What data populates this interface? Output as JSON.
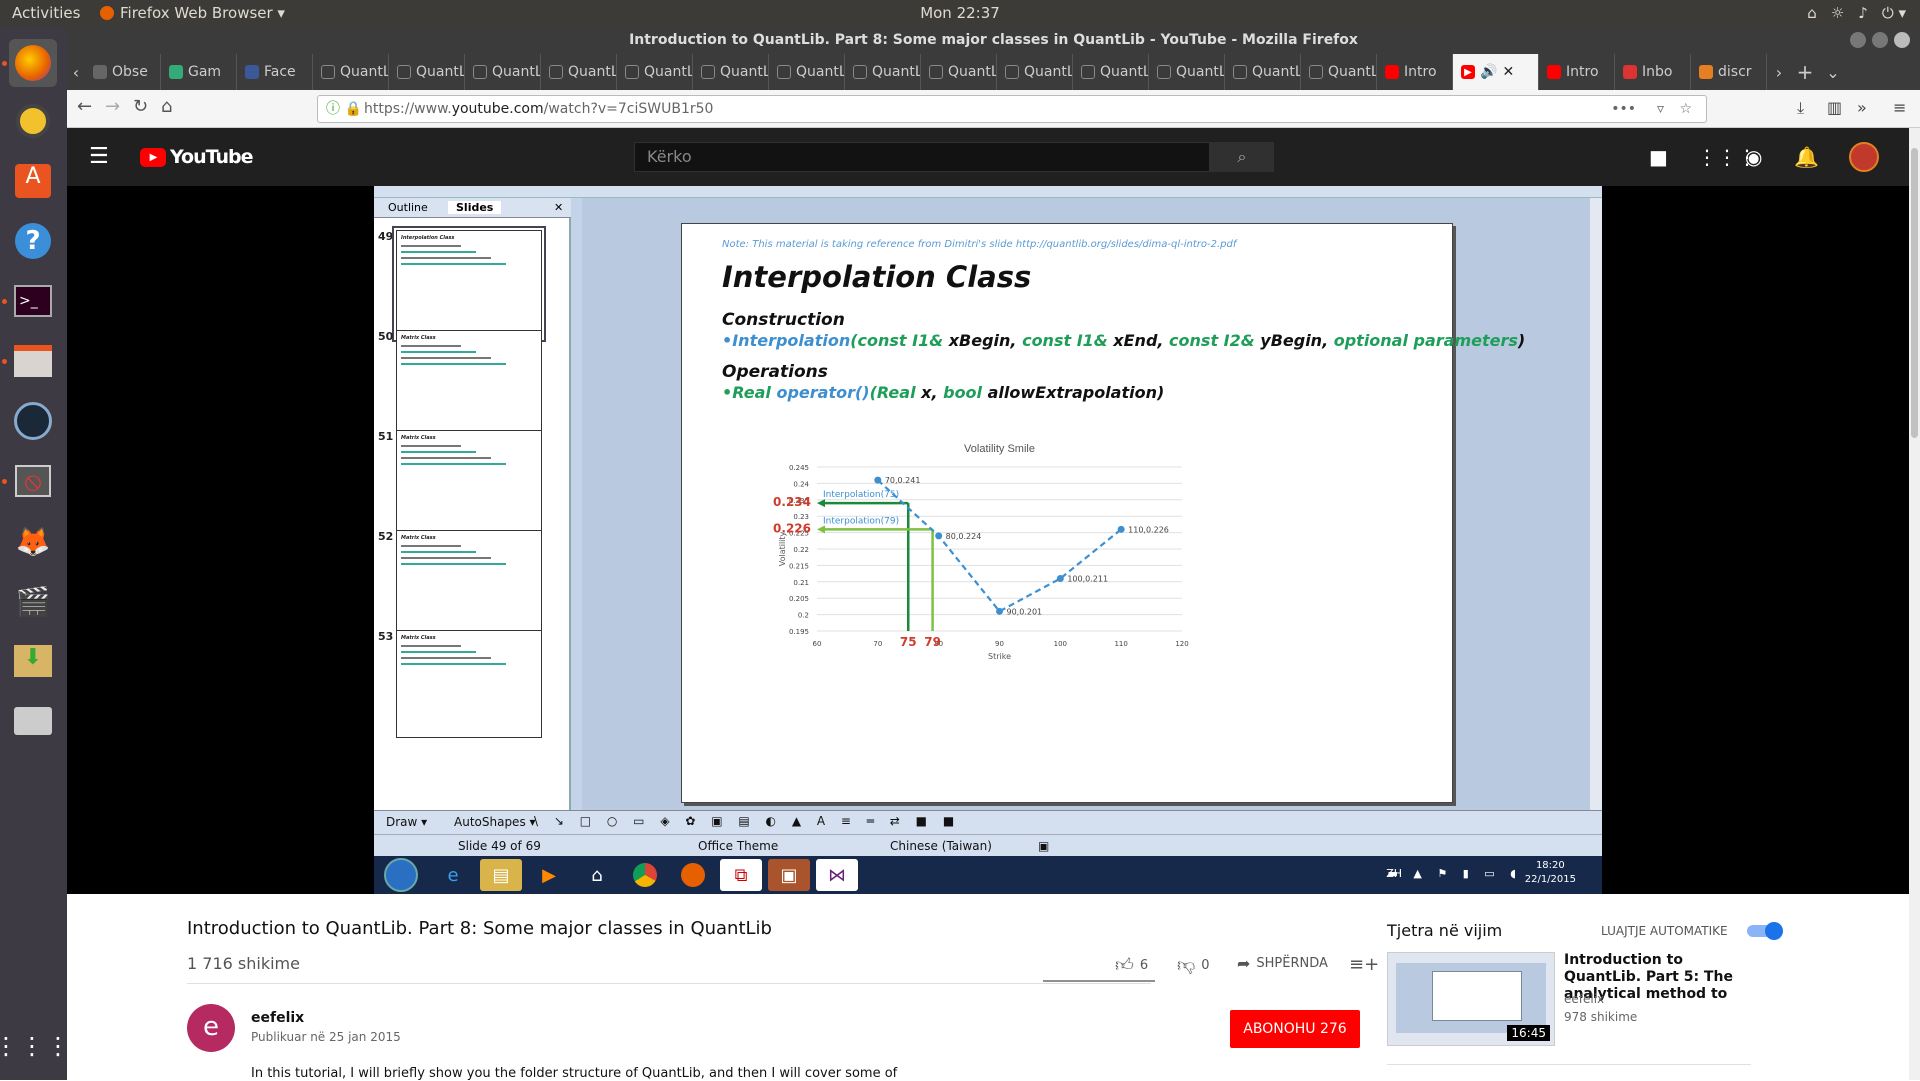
{
  "ubuntu": {
    "activities": "Activities",
    "app_menu": "Firefox Web Browser ▾",
    "clock": "Mon 22:37"
  },
  "firefox": {
    "window_title": "Introduction to QuantLib. Part 8: Some major classes in QuantLib - YouTube - Mozilla Firefox",
    "tabs": [
      {
        "label": "Obse",
        "color": "#666"
      },
      {
        "label": "Gam",
        "color": "#3a7"
      },
      {
        "label": "Face",
        "color": "#3b5998"
      },
      {
        "label": "QuantLi",
        "color": ""
      },
      {
        "label": "QuantLi",
        "color": ""
      },
      {
        "label": "QuantLi",
        "color": ""
      },
      {
        "label": "QuantLi",
        "color": ""
      },
      {
        "label": "QuantLi",
        "color": ""
      },
      {
        "label": "QuantLi",
        "color": ""
      },
      {
        "label": "QuantLi",
        "color": ""
      },
      {
        "label": "QuantLi",
        "color": ""
      },
      {
        "label": "QuantLi",
        "color": ""
      },
      {
        "label": "QuantLi",
        "color": ""
      },
      {
        "label": "QuantLi",
        "color": ""
      },
      {
        "label": "QuantLi",
        "color": ""
      },
      {
        "label": "QuantLi",
        "color": ""
      },
      {
        "label": "QuantLi",
        "color": ""
      },
      {
        "label": "Intro",
        "color": "#f00"
      }
    ],
    "active_tab_label": "",
    "tabs_after": [
      {
        "label": "Intro",
        "color": "#f00"
      },
      {
        "label": "Inbo",
        "color": "#d33"
      },
      {
        "label": "discr",
        "color": "#e67e22"
      }
    ],
    "url_prefix": "https://www.",
    "url_domain": "youtube.com",
    "url_path": "/watch?v=7ciSWUB1r50"
  },
  "youtube": {
    "logo": "YouTube",
    "search_placeholder": "Kërko",
    "video_title": "Introduction to QuantLib. Part 8: Some major classes in QuantLib",
    "views": "1 716 shikime",
    "likes": "6",
    "dislikes": "0",
    "share": "SHPËRNDA",
    "channel_initial": "e",
    "channel_name": "eefelix",
    "published": "Publikuar në 25 jan 2015",
    "subscribe": "ABONOHU",
    "subscribers": "276",
    "description": "In this tutorial, I will briefly show you the folder structure of QuantLib, and then I will cover some of",
    "up_next": "Tjetra në vijim",
    "autoplay": "LUAJTJE AUTOMATIKE",
    "rec": {
      "title": "Introduction to QuantLib. Part 5: The analytical method to",
      "channel": "eefelix",
      "views": "978 shikime",
      "duration": "16:45"
    }
  },
  "ppt": {
    "tab_outline": "Outline",
    "tab_slides": "Slides",
    "thumbs": [
      {
        "num": "49",
        "title": "Interpolation Class"
      },
      {
        "num": "50",
        "title": "Matrix Class"
      },
      {
        "num": "51",
        "title": "Matrix Class"
      },
      {
        "num": "52",
        "title": "Matrix Class"
      },
      {
        "num": "53",
        "title": "Matrix Class"
      }
    ],
    "note": "Note: This material is taking reference from Dimitri's slide http://quantlib.org/slides/dima-ql-intro-2.pdf",
    "title": "Interpolation Class",
    "construction": "Construction",
    "operations": "Operations",
    "code1": {
      "bullet": "•Interpolation",
      "p1": "(const I1& ",
      "a1": "xBegin, ",
      "p2": "const I1& ",
      "a2": "xEnd, ",
      "p3": "const I2& ",
      "a3": "yBegin, ",
      "p4": "optional parameters",
      "end": ")"
    },
    "code2": {
      "bullet": "•Real ",
      "op": "operator()",
      "p1": "(Real ",
      "a1": "x, ",
      "p2": "bool ",
      "a2": "allowExtrapolation)"
    },
    "drawbar": {
      "draw": "Draw ▾",
      "autoshapes": "AutoShapes ▾"
    },
    "status": {
      "slide": "Slide 49 of 69",
      "theme": "Office Theme",
      "lang": "Chinese (Taiwan)"
    },
    "taskbar": {
      "lang": "ZH",
      "time": "18:20",
      "date": "22/1/2015"
    }
  },
  "chart_data": {
    "type": "line",
    "title": "Volatility Smile",
    "xlabel": "Strike",
    "ylabel": "Volatility",
    "xlim": [
      60,
      120
    ],
    "ylim": [
      0.195,
      0.245
    ],
    "x_ticks": [
      "60",
      "70",
      "80",
      "90",
      "100",
      "110",
      "120"
    ],
    "y_ticks": [
      "0.245",
      "0.24",
      "0.235",
      "0.23",
      "0.225",
      "0.22",
      "0.215",
      "0.21",
      "0.205",
      "0.2",
      "0.195"
    ],
    "points": [
      {
        "x": 70,
        "y": 0.241,
        "label": "70,0.241"
      },
      {
        "x": 80,
        "y": 0.224,
        "label": "80,0.224"
      },
      {
        "x": 90,
        "y": 0.201,
        "label": "90,0.201"
      },
      {
        "x": 100,
        "y": 0.211,
        "label": "100,0.211"
      },
      {
        "x": 110,
        "y": 0.226,
        "label": "110,0.226"
      }
    ],
    "annotations": [
      {
        "x": 75,
        "y": 0.234,
        "text": "Interpolation(75)",
        "strike_label": "75",
        "value_label": "0.234",
        "color": "#1a8a3a"
      },
      {
        "x": 79,
        "y": 0.226,
        "text": "Interpolation(79)",
        "strike_label": "79",
        "value_label": "0.226",
        "color": "#7cc143"
      }
    ],
    "colors": {
      "line": "#3d8fd0",
      "grid": "#e0e0e0",
      "value_label": "#d03c2c"
    }
  }
}
